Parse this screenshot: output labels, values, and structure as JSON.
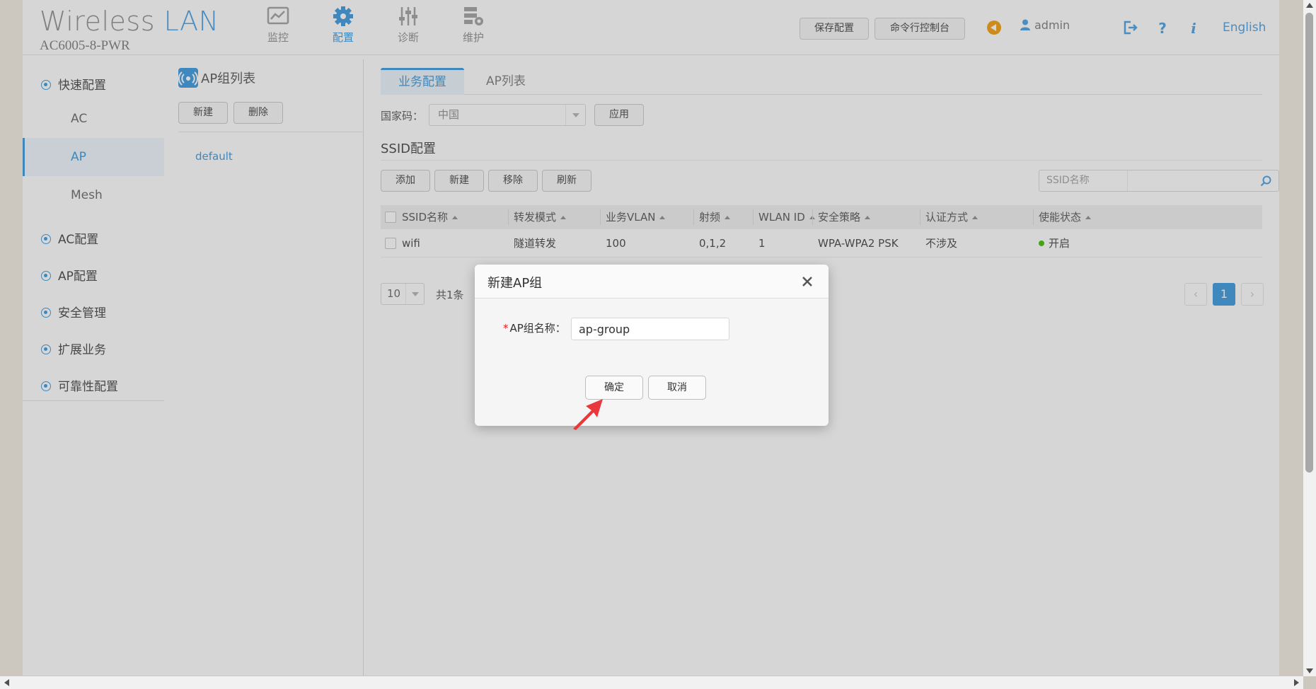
{
  "header": {
    "brand_left": "Wireless",
    "brand_right": "LAN",
    "model": "AC6005-8-PWR",
    "nav": [
      {
        "label": "监控",
        "icon": "monitor-icon"
      },
      {
        "label": "配置",
        "icon": "gear-icon",
        "active": true
      },
      {
        "label": "诊断",
        "icon": "sliders-icon"
      },
      {
        "label": "维护",
        "icon": "maintenance-icon"
      }
    ],
    "save_label": "保存配置",
    "cli_label": "命令行控制台",
    "user": "admin",
    "language": "English"
  },
  "sidebar": {
    "groups": [
      {
        "label": "快速配置",
        "expanded": true
      },
      {
        "label": "AC配置"
      },
      {
        "label": "AP配置"
      },
      {
        "label": "安全管理"
      },
      {
        "label": "扩展业务"
      },
      {
        "label": "可靠性配置"
      }
    ],
    "quick_items": [
      {
        "label": "AC"
      },
      {
        "label": "AP",
        "active": true
      },
      {
        "label": "Mesh"
      }
    ]
  },
  "group_panel": {
    "title": "AP组列表",
    "new_label": "新建",
    "delete_label": "删除",
    "groups": [
      "default"
    ]
  },
  "main": {
    "tabs": [
      {
        "label": "业务配置",
        "active": true
      },
      {
        "label": "AP列表"
      }
    ],
    "country_label": "国家码：",
    "country_value": "中国",
    "apply_label": "应用",
    "ssid_title": "SSID配置",
    "toolbar": {
      "add": "添加",
      "new": "新建",
      "remove": "移除",
      "refresh": "刷新"
    },
    "search_placeholder": "SSID名称",
    "columns": [
      "SSID名称",
      "转发模式",
      "业务VLAN",
      "射频",
      "WLAN ID",
      "安全策略",
      "认证方式",
      "使能状态"
    ],
    "rows": [
      [
        "wifi",
        "隧道转发",
        "100",
        "0,1,2",
        "1",
        "WPA-WPA2 PSK",
        "不涉及",
        "开启"
      ]
    ],
    "page_size": "10",
    "total": "共1条",
    "current_page": "1"
  },
  "modal": {
    "title": "新建AP组",
    "required_mark": "*",
    "field_label": "AP组名称：",
    "field_value": "ap-group",
    "ok_label": "确定",
    "cancel_label": "取消"
  },
  "colors": {
    "accent": "#4aa3e3",
    "status_on": "#52c41a",
    "required": "#e02020",
    "pointer": "#e8383d"
  }
}
